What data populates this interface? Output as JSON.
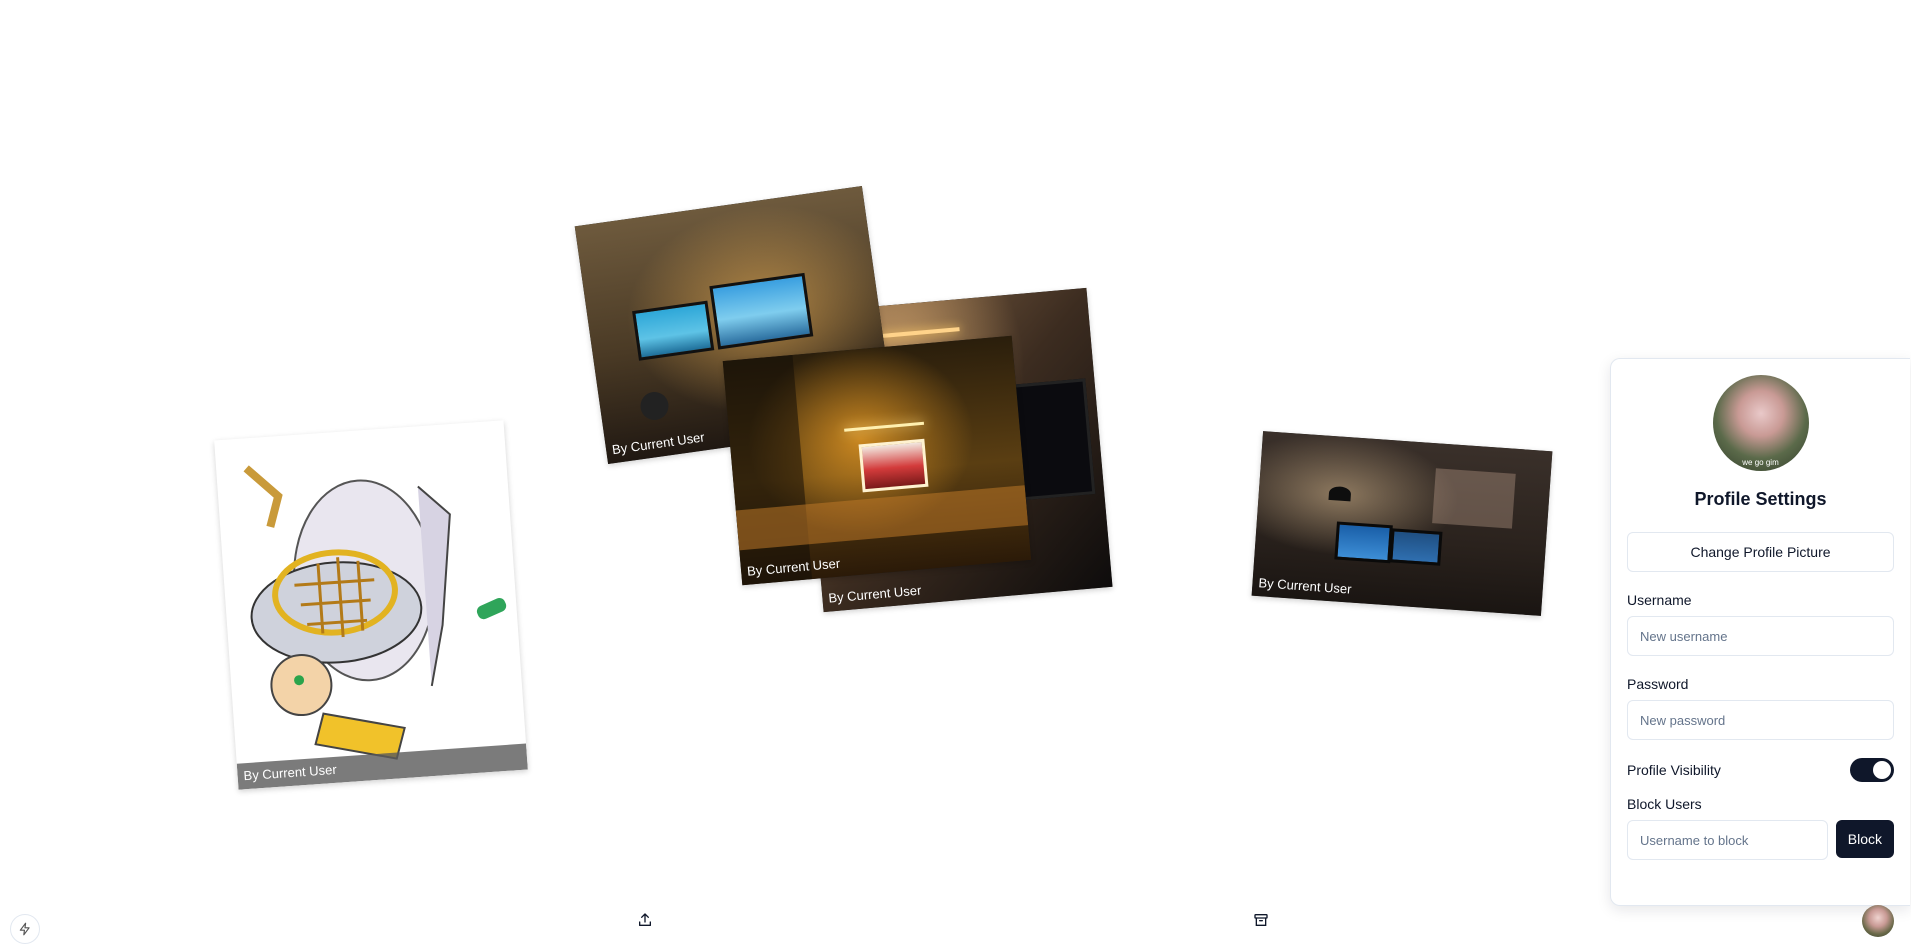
{
  "gallery": {
    "photos": [
      {
        "caption": "By Current User"
      },
      {
        "caption": "By Current User"
      },
      {
        "caption": "By Current User"
      },
      {
        "caption": "By Current User"
      },
      {
        "caption": "By Current User"
      }
    ]
  },
  "profile": {
    "avatar_tag": "we go gim",
    "title": "Profile Settings",
    "change_picture_label": "Change Profile Picture",
    "username_label": "Username",
    "username_placeholder": "New username",
    "password_label": "Password",
    "password_placeholder": "New password",
    "visibility_label": "Profile Visibility",
    "visibility_on": true,
    "block_label": "Block Users",
    "block_placeholder": "Username to block",
    "block_button": "Block"
  },
  "toolbar": {
    "icons": [
      "bolt-icon",
      "upload-icon",
      "archive-icon",
      "avatar"
    ]
  },
  "colors": {
    "primary": "#0f172a",
    "border": "#e2e8f0",
    "muted": "#64748b"
  }
}
